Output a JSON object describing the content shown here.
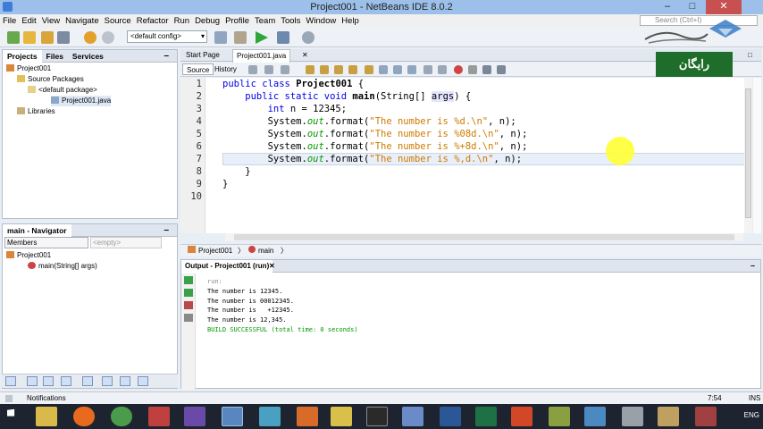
{
  "window": {
    "title": "Project001 - NetBeans IDE 8.0.2",
    "minimize": "–",
    "maximize": "□",
    "close": "✕"
  },
  "menu": [
    "File",
    "Edit",
    "View",
    "Navigate",
    "Source",
    "Refactor",
    "Run",
    "Debug",
    "Profile",
    "Team",
    "Tools",
    "Window",
    "Help"
  ],
  "search": {
    "placeholder": "Search (Ctrl+I)"
  },
  "toolbar": {
    "config_value": "<default config>"
  },
  "projects_panel": {
    "tabs": [
      "Projects",
      "Files",
      "Services"
    ],
    "tree": [
      "Project001",
      "Source Packages",
      "<default package>",
      "Project001.java",
      "Libraries"
    ]
  },
  "navigator_panel": {
    "title": "main - Navigator",
    "filter": "Members",
    "empty": "<empty>",
    "tree": [
      "Project001",
      "main(String[] args)"
    ]
  },
  "editor_tabs": [
    "Start Page",
    "Project001.java"
  ],
  "source_bar": {
    "source": "Source",
    "history": "History"
  },
  "code": {
    "line_numbers": [
      "1",
      "2",
      "3",
      "4",
      "5",
      "6",
      "7",
      "8",
      "9",
      "10"
    ],
    "lines": [
      [
        {
          "t": "public class ",
          "c": "kw"
        },
        {
          "t": "Project001",
          "c": "bold"
        },
        {
          "t": " {",
          "c": ""
        }
      ],
      [
        {
          "t": "    public static void ",
          "c": "kw"
        },
        {
          "t": "main",
          "c": "bold"
        },
        {
          "t": "(String[] ",
          "c": ""
        },
        {
          "t": "args",
          "c": "hl"
        },
        {
          "t": ") {",
          "c": ""
        }
      ],
      [
        {
          "t": "        int ",
          "c": "kw"
        },
        {
          "t": "n = 12345;",
          "c": ""
        }
      ],
      [
        {
          "t": "        System.",
          "c": ""
        },
        {
          "t": "out",
          "c": "fld"
        },
        {
          "t": ".format(",
          "c": ""
        },
        {
          "t": "\"The number is %d.\\n\"",
          "c": "str"
        },
        {
          "t": ", n);",
          "c": ""
        }
      ],
      [
        {
          "t": "        System.",
          "c": ""
        },
        {
          "t": "out",
          "c": "fld"
        },
        {
          "t": ".format(",
          "c": ""
        },
        {
          "t": "\"The number is %08d.\\n\"",
          "c": "str"
        },
        {
          "t": ", n);",
          "c": ""
        }
      ],
      [
        {
          "t": "        System.",
          "c": ""
        },
        {
          "t": "out",
          "c": "fld"
        },
        {
          "t": ".format(",
          "c": ""
        },
        {
          "t": "\"The number is %+8d.\\n\"",
          "c": "str"
        },
        {
          "t": ", n);",
          "c": ""
        }
      ],
      [
        {
          "t": "        System.",
          "c": ""
        },
        {
          "t": "out",
          "c": "fld"
        },
        {
          "t": ".format(",
          "c": ""
        },
        {
          "t": "\"The number is %,d.\\n\"",
          "c": "str"
        },
        {
          "t": ", n);",
          "c": ""
        }
      ],
      [
        {
          "t": "    }",
          "c": ""
        }
      ],
      [
        {
          "t": "}",
          "c": ""
        }
      ],
      [
        {
          "t": "",
          "c": ""
        }
      ]
    ]
  },
  "breadcrumbs": [
    "Project001",
    "main"
  ],
  "output": {
    "title": "Output - Project001 (run)",
    "lines": [
      "run:",
      "The number is 12345.",
      "The number is 00012345.",
      "The number is   +12345.",
      "The number is 12,345.",
      "BUILD SUCCESSFUL (total time: 0 seconds)"
    ]
  },
  "status": {
    "notifications": "Notifications",
    "position": "7:54",
    "mode": "INS"
  },
  "taskbar": {
    "lang": "ENG"
  },
  "promo": {
    "badge": "رایگان"
  },
  "colors": {
    "keyword": "#0000e6",
    "string": "#ce7b00",
    "field": "#009900",
    "build_success": "#009900"
  }
}
